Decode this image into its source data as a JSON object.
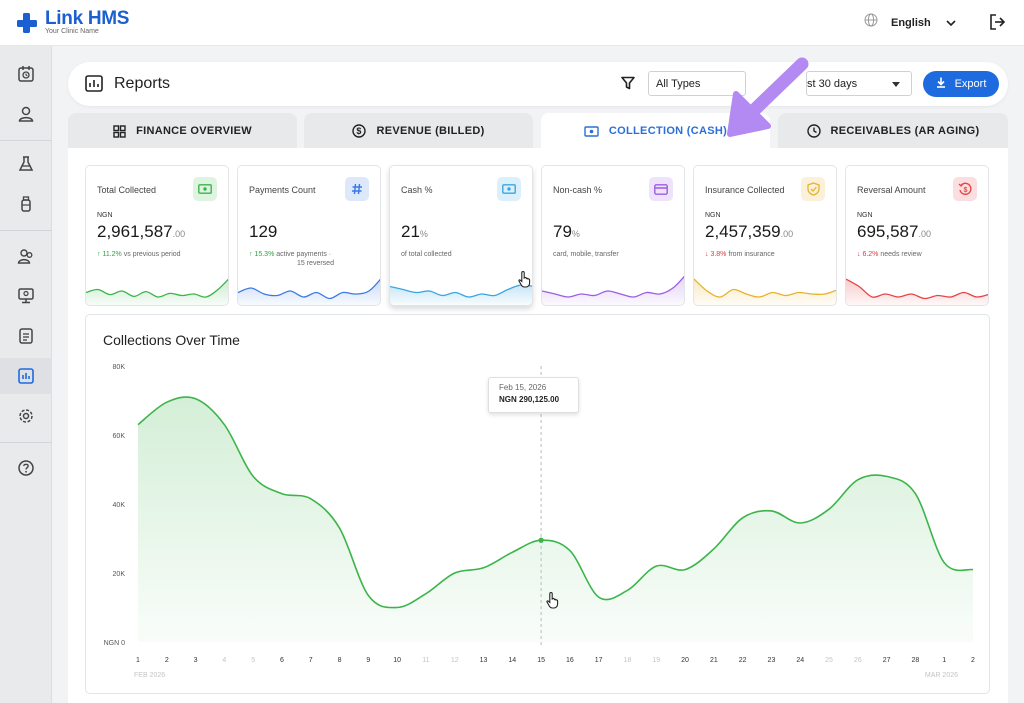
{
  "app": {
    "name": "Link HMS",
    "subtitle": "Your Clinic Name",
    "language": "English"
  },
  "header": {
    "title": "Reports",
    "type_filter": "All Types",
    "range_filter": "st 30 days",
    "export_label": "Export"
  },
  "tabs": [
    {
      "label": "FINANCE OVERVIEW",
      "icon": "grid-icon"
    },
    {
      "label": "REVENUE (BILLED)",
      "icon": "dollar-circle-icon"
    },
    {
      "label": "COLLECTION (CASH)",
      "icon": "cash-icon",
      "active": true
    },
    {
      "label": "RECEIVABLES (AR AGING)",
      "icon": "clock-icon"
    }
  ],
  "kpis": [
    {
      "title": "Total Collected",
      "currency": "NGN",
      "value": "2,961,587",
      "decimals": ".00",
      "trend": "11.2%",
      "trend_dir": "up",
      "note": "vs previous period",
      "color": "#3bb54a",
      "badge_bg": "#dff3e1",
      "icon": "cash-icon",
      "sparkline": [
        0.35,
        0.45,
        0.28,
        0.4,
        0.22,
        0.38,
        0.2,
        0.32,
        0.25,
        0.3,
        0.2,
        0.45,
        0.85
      ]
    },
    {
      "title": "Payments Count",
      "currency": "",
      "value": "129",
      "decimals": "",
      "trend": "15.3%",
      "trend_dir": "up",
      "note": "active payments ·",
      "note2": "15 reversed",
      "color": "#3b78e7",
      "badge_bg": "#dde8fb",
      "icon": "hash-icon",
      "sparkline": [
        0.35,
        0.5,
        0.3,
        0.25,
        0.4,
        0.2,
        0.35,
        0.15,
        0.35,
        0.3,
        0.4,
        0.85
      ]
    },
    {
      "title": "Cash %",
      "currency": "",
      "value": "21",
      "decimals": "%",
      "trend": "",
      "trend_dir": "",
      "note": "of total collected",
      "color": "#3aa6e0",
      "badge_bg": "#dcf0fb",
      "icon": "cash-icon",
      "sparkline": [
        0.55,
        0.45,
        0.35,
        0.4,
        0.25,
        0.35,
        0.2,
        0.3,
        0.25,
        0.45,
        0.6,
        0.55
      ]
    },
    {
      "title": "Non-cash %",
      "currency": "",
      "value": "79",
      "decimals": "%",
      "trend": "",
      "trend_dir": "",
      "note": "card, mobile, transfer",
      "color": "#9b5de5",
      "badge_bg": "#efe3fb",
      "icon": "card-icon",
      "sparkline": [
        0.4,
        0.3,
        0.2,
        0.3,
        0.25,
        0.4,
        0.3,
        0.2,
        0.35,
        0.3,
        0.5,
        0.95
      ]
    },
    {
      "title": "Insurance Collected",
      "currency": "NGN",
      "value": "2,457,359",
      "decimals": ".00",
      "trend": "3.8%",
      "trend_dir": "down",
      "note": "from insurance",
      "color": "#e8b32c",
      "badge_bg": "#fbf1da",
      "icon": "shield-check-icon",
      "sparkline": [
        0.8,
        0.4,
        0.2,
        0.45,
        0.3,
        0.2,
        0.35,
        0.25,
        0.35,
        0.3,
        0.3,
        0.45
      ]
    },
    {
      "title": "Reversal Amount",
      "currency": "NGN",
      "value": "695,587",
      "decimals": ".00",
      "trend": "6.2%",
      "trend_dir": "down",
      "note": "needs review",
      "color": "#e64548",
      "badge_bg": "#fbdfe0",
      "icon": "undo-dollar-icon",
      "sparkline": [
        0.8,
        0.55,
        0.2,
        0.3,
        0.2,
        0.3,
        0.15,
        0.25,
        0.2,
        0.35,
        0.2,
        0.3
      ]
    }
  ],
  "chart_title": "Collections Over Time",
  "chart_data": {
    "type": "area",
    "title": "Collections Over Time",
    "y_ticks": [
      "NGN 0",
      "20K",
      "40K",
      "60K",
      "80K"
    ],
    "ylim": [
      0,
      80000
    ],
    "x_labels": [
      "1",
      "2",
      "3",
      "4",
      "5",
      "6",
      "7",
      "8",
      "9",
      "10",
      "11",
      "12",
      "13",
      "14",
      "15",
      "16",
      "17",
      "18",
      "19",
      "20",
      "21",
      "22",
      "23",
      "24",
      "25",
      "26",
      "27",
      "28",
      "1",
      "2"
    ],
    "x_dim": [
      false,
      false,
      false,
      true,
      true,
      false,
      false,
      false,
      false,
      false,
      true,
      true,
      false,
      false,
      false,
      false,
      false,
      true,
      true,
      false,
      false,
      false,
      false,
      false,
      true,
      true,
      false,
      false,
      false,
      false
    ],
    "month_start": "FEB 2026",
    "month_end": "MAR 2026",
    "series": [
      {
        "values": [
          63000,
          69500,
          70500,
          63000,
          48000,
          43000,
          41500,
          33000,
          13500,
          10000,
          14000,
          20000,
          21500,
          26000,
          29500,
          26500,
          13000,
          15000,
          22000,
          21000,
          27000,
          36000,
          38000,
          34500,
          38500,
          47000,
          48000,
          43000,
          23000,
          21000
        ]
      }
    ],
    "color": "#3bb54a",
    "grid": false,
    "legend": "none"
  },
  "tooltip": {
    "date": "Feb 15, 2026",
    "value": "NGN 290,125.00"
  },
  "sidebar": {
    "items": [
      "calendar-clock-icon",
      "user-icon",
      "flask-icon",
      "bottle-icon",
      "users-icon",
      "monitor-icon",
      "clipboard-icon",
      "reports-icon",
      "gear-icon",
      "help-icon"
    ]
  }
}
